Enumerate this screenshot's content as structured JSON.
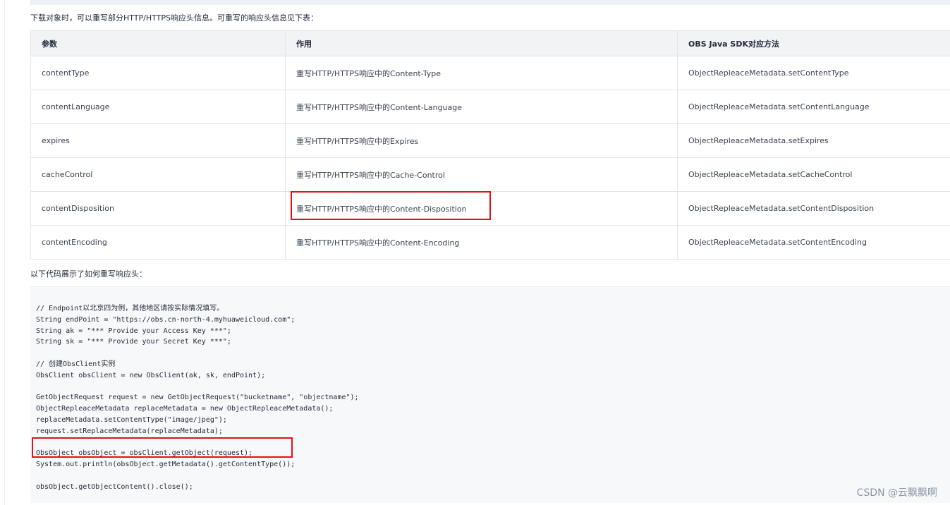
{
  "intro_text": "下载对象时，可以重写部分HTTP/HTTPS响应头信息。可重写的响应头信息见下表：",
  "table": {
    "headers": [
      "参数",
      "作用",
      "OBS Java SDK对应方法"
    ],
    "rows": [
      [
        "contentType",
        "重写HTTP/HTTPS响应中的Content-Type",
        "ObjectRepleaceMetadata.setContentType"
      ],
      [
        "contentLanguage",
        "重写HTTP/HTTPS响应中的Content-Language",
        "ObjectRepleaceMetadata.setContentLanguage"
      ],
      [
        "expires",
        "重写HTTP/HTTPS响应中的Expires",
        "ObjectRepleaceMetadata.setExpires"
      ],
      [
        "cacheControl",
        "重写HTTP/HTTPS响应中的Cache-Control",
        "ObjectRepleaceMetadata.setCacheControl"
      ],
      [
        "contentDisposition",
        "重写HTTP/HTTPS响应中的Content-Disposition",
        "ObjectRepleaceMetadata.setContentDisposition"
      ],
      [
        "contentEncoding",
        "重写HTTP/HTTPS响应中的Content-Encoding",
        "ObjectRepleaceMetadata.setContentEncoding"
      ]
    ]
  },
  "code_intro_text": "以下代码展示了如何重写响应头：",
  "code_lines": [
    "// Endpoint以北京四为例，其他地区请按实际情况填写。",
    "String endPoint = \"https://obs.cn-north-4.myhuaweicloud.com\";",
    "String ak = \"*** Provide your Access Key ***\";",
    "String sk = \"*** Provide your Secret Key ***\";",
    "",
    "// 创建ObsClient实例",
    "ObsClient obsClient = new ObsClient(ak, sk, endPoint);",
    "",
    "GetObjectRequest request = new GetObjectRequest(\"bucketname\", \"objectname\");",
    "ObjectRepleaceMetadata replaceMetadata = new ObjectRepleaceMetadata();",
    "replaceMetadata.setContentType(\"image/jpeg\");",
    "request.setReplaceMetadata(replaceMetadata);",
    "",
    "ObsObject obsObject = obsClient.getObject(request);",
    "System.out.println(obsObject.getMetadata().getContentType());",
    "",
    "obsObject.getObjectContent().close();"
  ],
  "watermark": "CSDN @云飘飘啊",
  "colors": {
    "highlight": "#e0131a",
    "header_bg": "#f2f3f5",
    "code_bg": "#f7f8fa"
  }
}
